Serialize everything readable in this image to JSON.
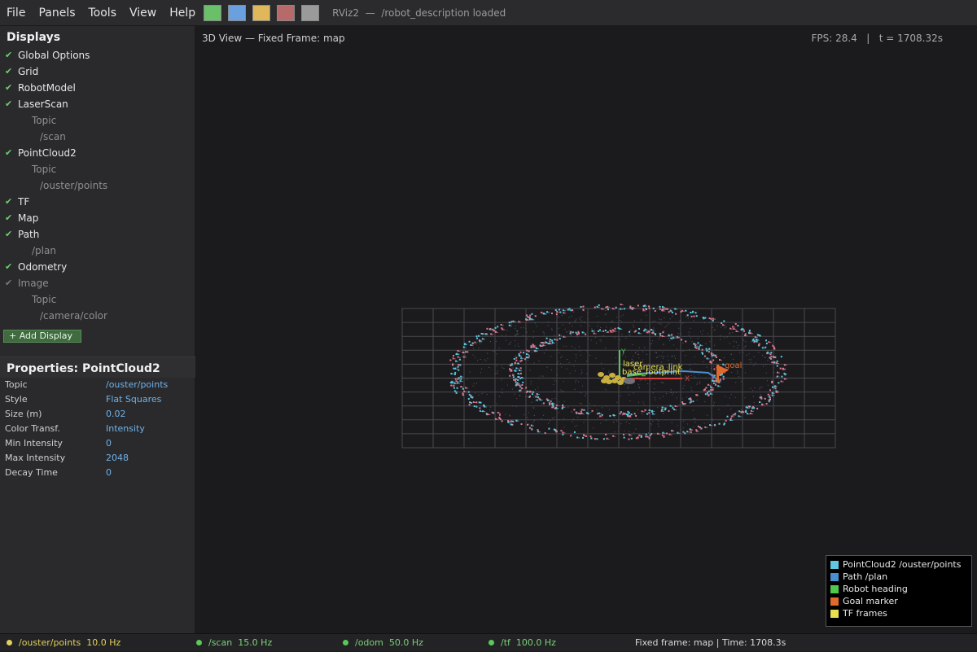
{
  "menubar": {
    "items": [
      "File",
      "Panels",
      "Tools",
      "View",
      "Help"
    ],
    "tool_colors": [
      "#6abf69",
      "#6a9fe0",
      "#e0b85a",
      "#b86a6a",
      "#9a9a9a"
    ],
    "app_title": "RViz2",
    "separator": "—",
    "status_text": "/robot_description loaded"
  },
  "displays": {
    "header": "Displays",
    "rows": [
      {
        "label": "Global Options",
        "check": true,
        "level": 0,
        "dim": false
      },
      {
        "label": "Grid",
        "check": true,
        "level": 0,
        "dim": false
      },
      {
        "label": "RobotModel",
        "check": true,
        "level": 0,
        "dim": false
      },
      {
        "label": "LaserScan",
        "check": true,
        "level": 0,
        "dim": false
      },
      {
        "label": "Topic",
        "check": false,
        "level": 1,
        "dim": true
      },
      {
        "label": "/scan",
        "check": false,
        "level": 2,
        "dim": true
      },
      {
        "label": "PointCloud2",
        "check": true,
        "level": 0,
        "dim": false
      },
      {
        "label": "Topic",
        "check": false,
        "level": 1,
        "dim": true
      },
      {
        "label": "/ouster/points",
        "check": false,
        "level": 2,
        "dim": true
      },
      {
        "label": "TF",
        "check": true,
        "level": 0,
        "dim": false
      },
      {
        "label": "Map",
        "check": true,
        "level": 0,
        "dim": false
      },
      {
        "label": "Path",
        "check": true,
        "level": 0,
        "dim": false
      },
      {
        "label": "/plan",
        "check": false,
        "level": 1,
        "dim": true
      },
      {
        "label": "Odometry",
        "check": true,
        "level": 0,
        "dim": false
      },
      {
        "label": "Image",
        "check": true,
        "level": 0,
        "dim": true
      },
      {
        "label": "Topic",
        "check": false,
        "level": 1,
        "dim": true
      },
      {
        "label": "/camera/color",
        "check": false,
        "level": 2,
        "dim": true
      }
    ],
    "add_button": "+ Add Display"
  },
  "properties": {
    "header": "Properties: PointCloud2",
    "rows": [
      {
        "key": "Topic",
        "value": "/ouster/points"
      },
      {
        "key": "Style",
        "value": "Flat Squares"
      },
      {
        "key": "Size (m)",
        "value": "0.02"
      },
      {
        "key": "Color Transf.",
        "value": "Intensity"
      },
      {
        "key": "Min Intensity",
        "value": "0"
      },
      {
        "key": "Max Intensity",
        "value": "2048"
      },
      {
        "key": "Decay Time",
        "value": "0"
      }
    ]
  },
  "view": {
    "title": "3D View — Fixed Frame: map",
    "fps": "FPS: 28.4   |   t = 1708.32s",
    "frames": [
      {
        "name": "laser"
      },
      {
        "name": "camera_link"
      },
      {
        "name": "base_footprint"
      },
      {
        "name": "goal"
      }
    ],
    "axis_labels": {
      "x": "X",
      "y": "Y"
    },
    "colors": {
      "pointcloud_a": "#5fc8e0",
      "pointcloud_b": "#e07890",
      "grid": "#4a4a4e",
      "path": "#4a8fd0",
      "heading": "#4fc84f",
      "goal": "#e06a2a",
      "tf": "#e8e050"
    }
  },
  "legend": {
    "entries": [
      {
        "label": "PointCloud2 /ouster/points",
        "color": "#5fc8e0"
      },
      {
        "label": "Path /plan",
        "color": "#4a8fd0"
      },
      {
        "label": "Robot heading",
        "color": "#4fc84f"
      },
      {
        "label": "Goal marker",
        "color": "#e06a2a"
      },
      {
        "label": "TF frames",
        "color": "#e8e050"
      }
    ]
  },
  "statusbar": {
    "topics": [
      {
        "topic": "/ouster/points",
        "rate": "10.0 Hz",
        "color": "#e0d060"
      },
      {
        "topic": "/scan",
        "rate": "15.0 Hz",
        "color": "#5ac85a"
      },
      {
        "topic": "/odom",
        "rate": "50.0 Hz",
        "color": "#5ac85a"
      },
      {
        "topic": "/tf",
        "rate": "100.0 Hz",
        "color": "#5ac85a"
      }
    ],
    "frame_info": "Fixed frame: map    |    Time: 1708.3s"
  }
}
